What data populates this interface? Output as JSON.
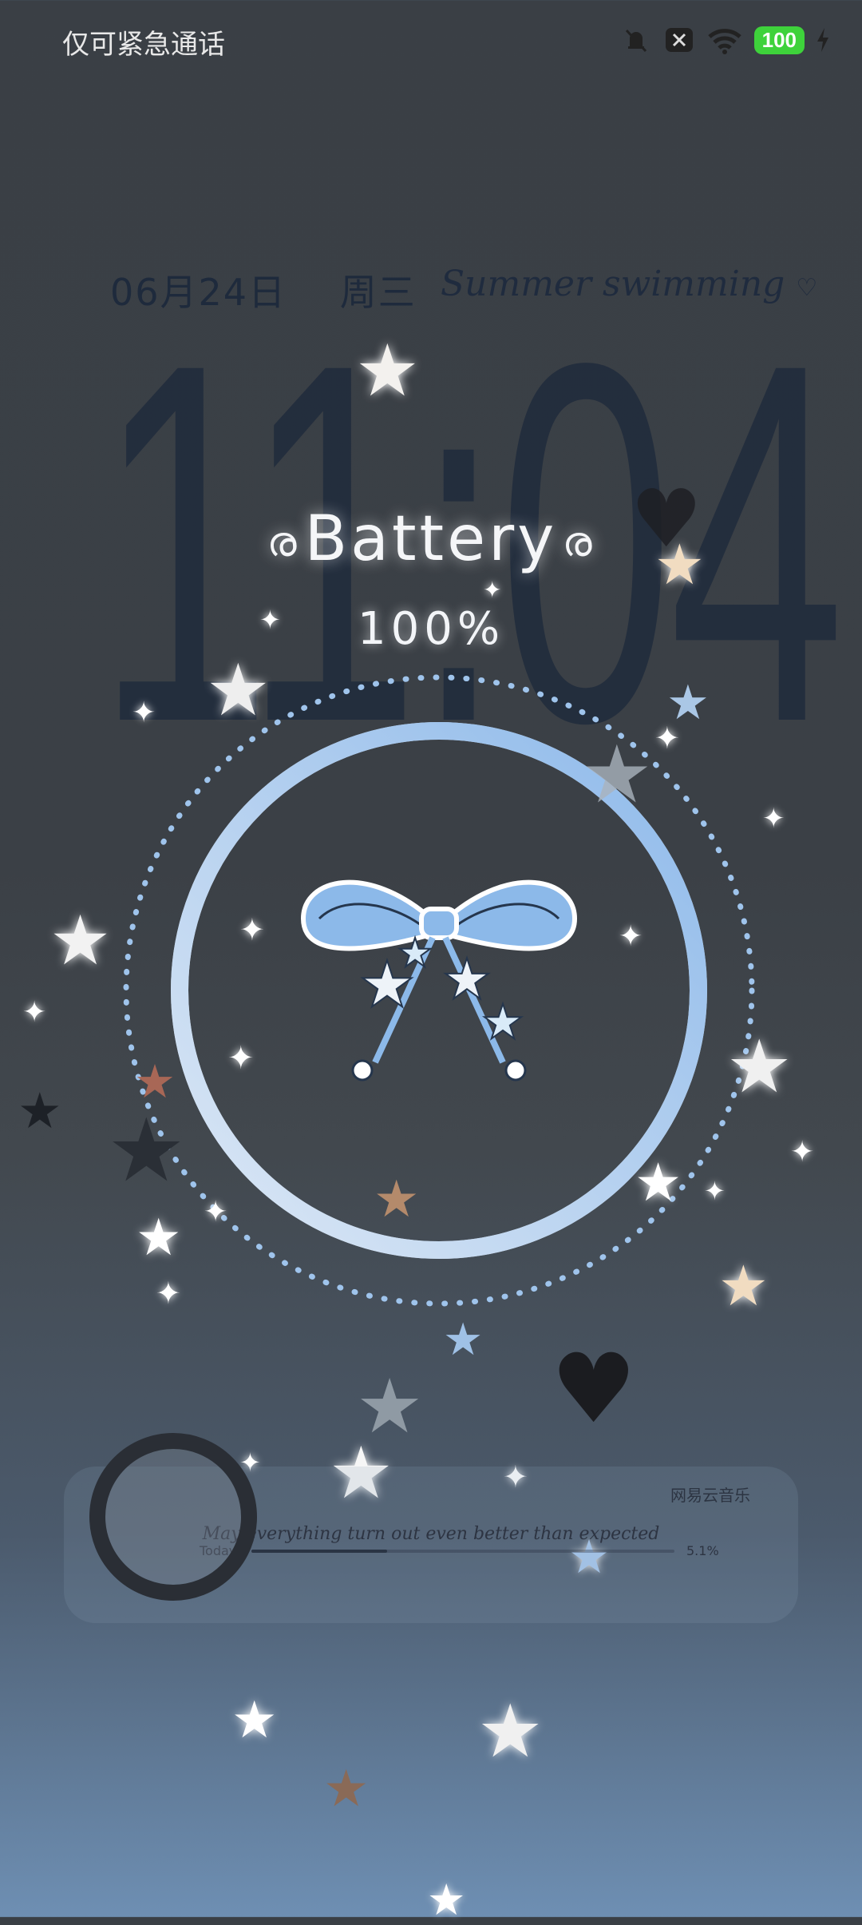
{
  "status_bar": {
    "carrier_text": "仅可紧急通话",
    "battery_badge": "100",
    "icons": [
      "mute-bell-icon",
      "x-box-icon",
      "wifi-icon",
      "charging-bolt-icon"
    ]
  },
  "lockscreen": {
    "date": "06月24日",
    "weekday": "周三",
    "tagline": "Summer swimming",
    "time": "11:04"
  },
  "battery_widget": {
    "title": "Battery",
    "percent_text": "100%",
    "level_percent": 100,
    "ring_colors": [
      "#cfe0f2",
      "#7fb0e6"
    ]
  },
  "music_widget": {
    "app_name": "网易云音乐",
    "lyric": "May everything turn out even better than expected",
    "left_label": "Today",
    "right_label": "5.1%",
    "progress": 0.32
  },
  "colors": {
    "accent_blue": "#8bb8ea",
    "battery_badge_bg": "#3ed23b",
    "clock_text": "#1f2b3c"
  }
}
